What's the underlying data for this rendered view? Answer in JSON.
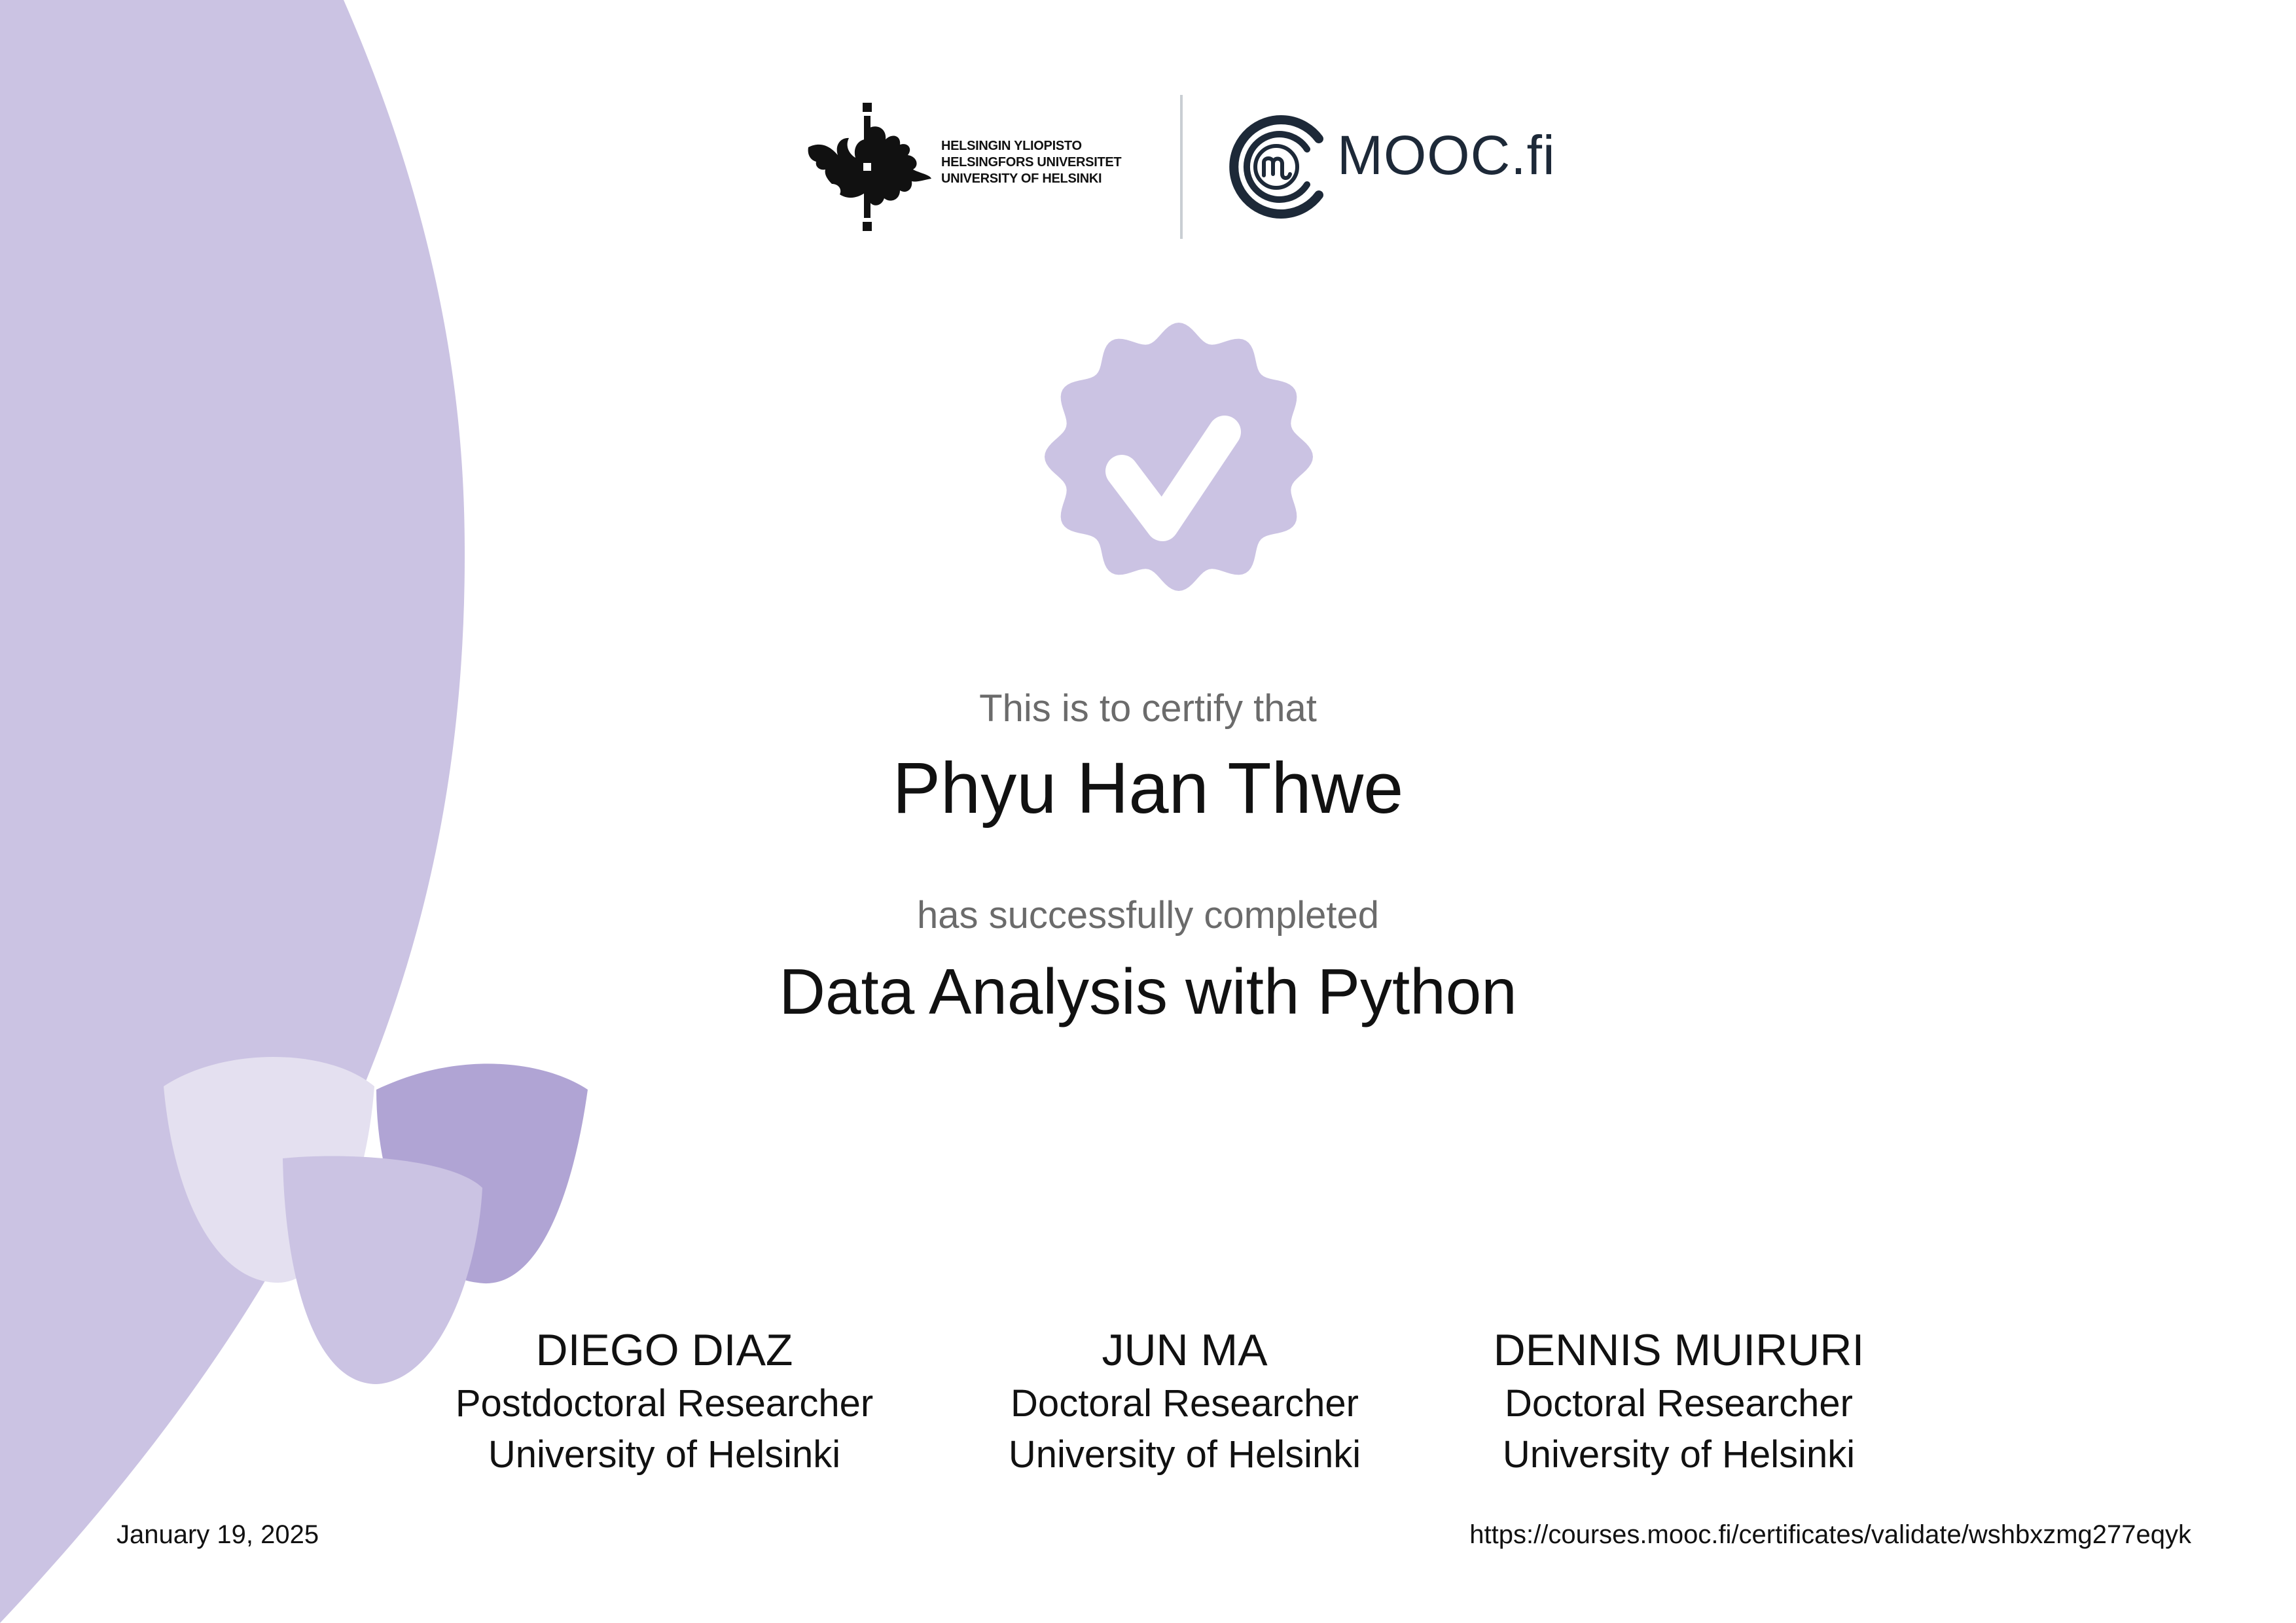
{
  "header": {
    "university_names": [
      "HELSINGIN YLIOPISTO",
      "HELSINGFORS UNIVERSITET",
      "UNIVERSITY OF HELSINKI"
    ],
    "university_logo_icon": "university-of-helsinki-flame-logo",
    "mooc_logo_icon": "mooc-fi-logo",
    "mooc_name": "MOOC.fi"
  },
  "badge": {
    "icon": "verified-checkmark-badge-icon",
    "color": "#cbc3e3"
  },
  "certificate": {
    "certify_text": "This is to certify that",
    "recipient_name": "Phyu Han Thwe",
    "completed_text": "has successfully completed",
    "course_title": "Data Analysis with Python"
  },
  "signatories": [
    {
      "name": "DIEGO DIAZ",
      "title": "Postdoctoral Researcher",
      "organization": "University of Helsinki"
    },
    {
      "name": "JUN MA",
      "title": "Doctoral Researcher",
      "organization": "University of Helsinki"
    },
    {
      "name": "DENNIS MUIRURI",
      "title": "Doctoral Researcher",
      "organization": "University of Helsinki"
    }
  ],
  "footer": {
    "date": "January 19, 2025",
    "validation_url": "https://courses.mooc.fi/certificates/validate/wshbxzmg277eqyk"
  },
  "colors": {
    "lavender_light": "#cbc3e3",
    "lavender_pale": "#e4e0f0",
    "lavender_dark": "#b0a4d4",
    "text_muted": "#6b6b6b",
    "text_dark": "#111111",
    "mooc_navy": "#1d2938"
  }
}
